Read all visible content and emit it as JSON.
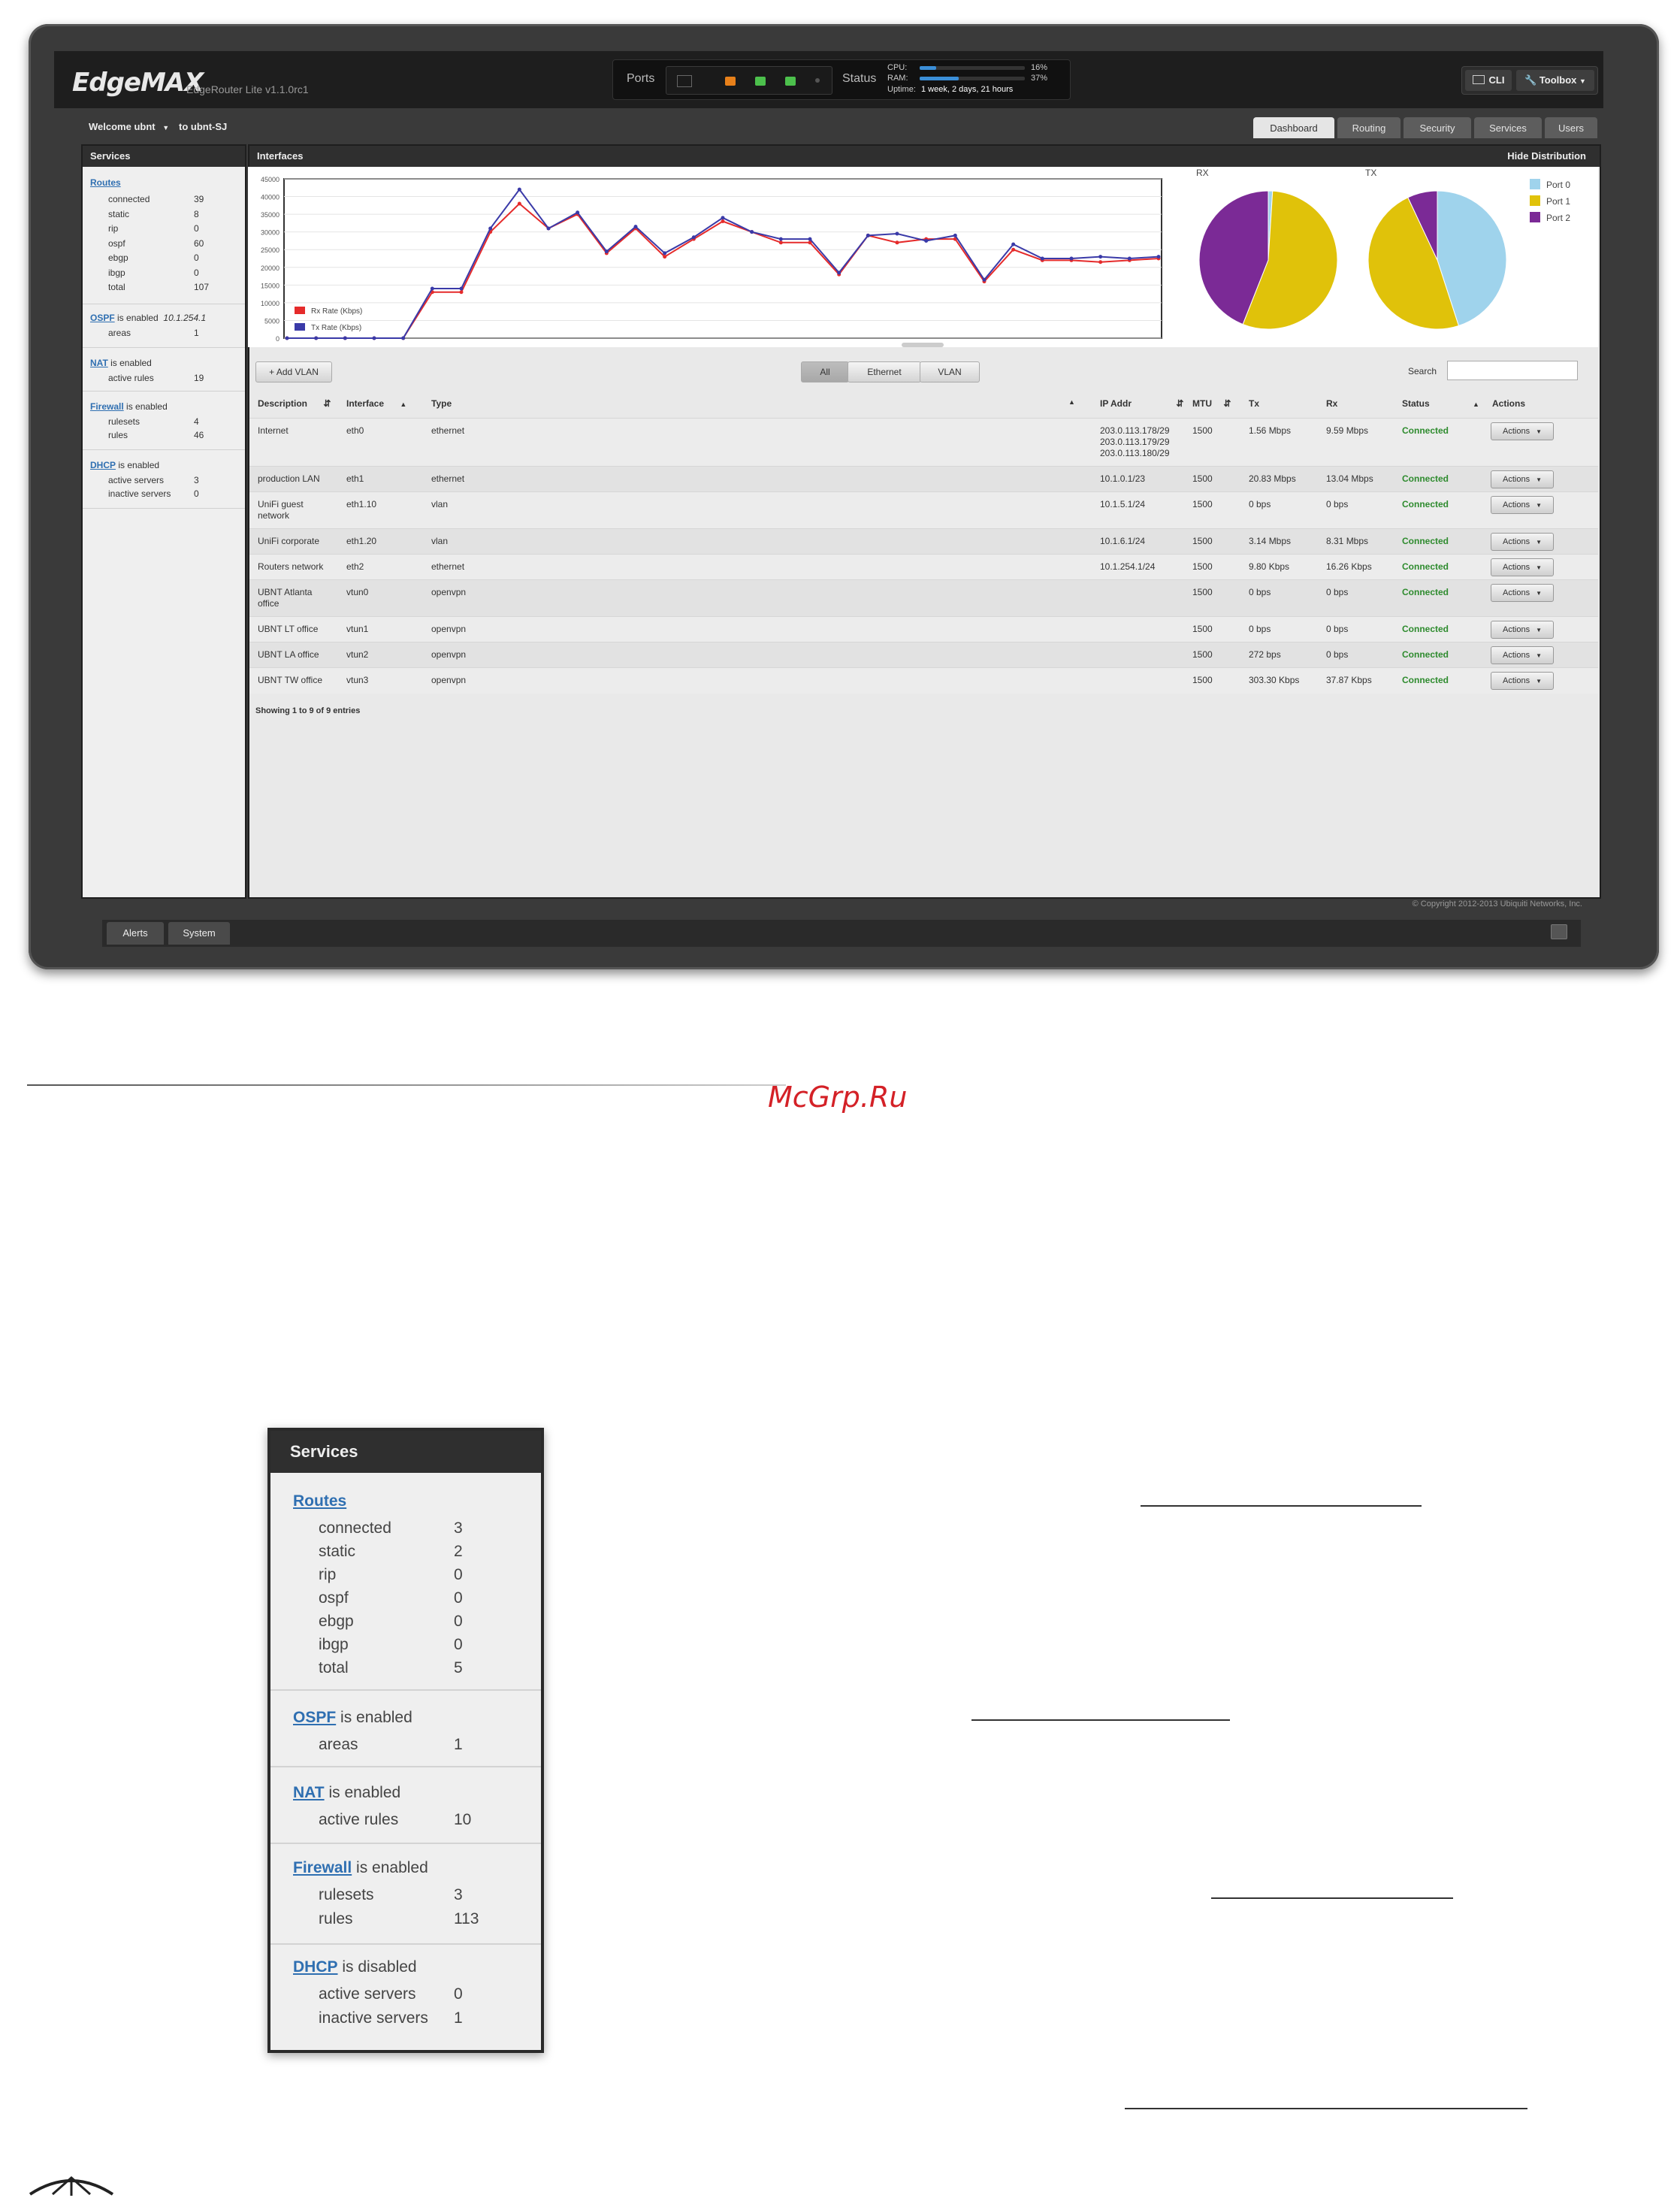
{
  "app": {
    "logo": "EdgeMAX",
    "product_version": "EdgeRouter Lite v1.1.0rc1",
    "ports_label": "Ports",
    "status_label": "Status",
    "cpu_label": "CPU:",
    "cpu_value": "16%",
    "cpu_fraction": 0.16,
    "ram_label": "RAM:",
    "ram_value": "37%",
    "ram_fraction": 0.37,
    "uptime_label": "Uptime:",
    "uptime_value": "1 week, 2 days, 21 hours",
    "cli_label": "CLI",
    "toolbox_label": "Toolbox"
  },
  "user": {
    "welcome": "Welcome ubnt",
    "host": "to ubnt-SJ"
  },
  "tabs": [
    "Dashboard",
    "Routing",
    "Security",
    "Services",
    "Users"
  ],
  "sidebar": {
    "title": "Services",
    "routes_link": "Routes",
    "routes": [
      {
        "label": "connected",
        "value": "39"
      },
      {
        "label": "static",
        "value": "8"
      },
      {
        "label": "rip",
        "value": "0"
      },
      {
        "label": "ospf",
        "value": "60"
      },
      {
        "label": "ebgp",
        "value": "0"
      },
      {
        "label": "ibgp",
        "value": "0"
      },
      {
        "label": "total",
        "value": "107"
      }
    ],
    "ospf_link": "OSPF",
    "ospf_status": "is enabled",
    "ospf_id": "10.1.254.1",
    "ospf_areas_label": "areas",
    "ospf_areas_value": "1",
    "nat_link": "NAT",
    "nat_status": "is enabled",
    "nat_rules_label": "active rules",
    "nat_rules_value": "19",
    "firewall_link": "Firewall",
    "firewall_status": "is enabled",
    "firewall_rulesets_label": "rulesets",
    "firewall_rulesets_value": "4",
    "firewall_rules_label": "rules",
    "firewall_rules_value": "46",
    "dhcp_link": "DHCP",
    "dhcp_status": "is enabled",
    "dhcp_active_label": "active servers",
    "dhcp_active_value": "3",
    "dhcp_inactive_label": "inactive servers",
    "dhcp_inactive_value": "0"
  },
  "interfaces_panel": {
    "title": "Interfaces",
    "hide_distribution": "Hide Distribution",
    "rx_label": "RX",
    "tx_label": "TX"
  },
  "chart_data": [
    {
      "type": "line",
      "title": "",
      "xlabel": "",
      "ylabel": "",
      "ylim": [
        0,
        45000
      ],
      "yticks": [
        "0",
        "5000",
        "10000",
        "15000",
        "20000",
        "25000",
        "30000",
        "35000",
        "40000",
        "45000"
      ],
      "x": [
        1,
        2,
        3,
        4,
        5,
        6,
        7,
        8,
        9,
        10,
        11,
        12,
        13,
        14,
        15,
        16,
        17,
        18,
        19,
        20,
        21,
        22,
        23,
        24,
        25,
        26,
        27,
        28,
        29,
        30,
        31
      ],
      "series": [
        {
          "name": "Rx Rate (Kbps)",
          "color": "#e52b2b",
          "values": [
            0,
            0,
            0,
            0,
            0,
            13000,
            13000,
            30000,
            38000,
            31000,
            35000,
            24000,
            31000,
            23000,
            28000,
            33000,
            30000,
            27000,
            27000,
            18000,
            29000,
            27000,
            28000,
            28000,
            16000,
            25000,
            22000,
            22000,
            21500,
            22000,
            22500
          ]
        },
        {
          "name": "Tx Rate (Kbps)",
          "color": "#3a3aa8",
          "values": [
            0,
            0,
            0,
            0,
            0,
            14000,
            14000,
            31000,
            42000,
            31000,
            35500,
            24500,
            31500,
            24000,
            28500,
            34000,
            30000,
            28000,
            28000,
            18500,
            29000,
            29500,
            27500,
            29000,
            16500,
            26500,
            22500,
            22500,
            23000,
            22500,
            23000
          ]
        }
      ]
    },
    {
      "type": "pie",
      "title": "RX",
      "categories": [
        "Port 0",
        "Port 1",
        "Port 2"
      ],
      "values": [
        1,
        55,
        44
      ],
      "colors": [
        "#9fd3ec",
        "#e0c20a",
        "#7b2a96"
      ]
    },
    {
      "type": "pie",
      "title": "TX",
      "categories": [
        "Port 0",
        "Port 1",
        "Port 2"
      ],
      "values": [
        45,
        48,
        7
      ],
      "colors": [
        "#9fd3ec",
        "#e0c20a",
        "#7b2a96"
      ]
    }
  ],
  "table": {
    "add_vlan": "+ Add VLAN",
    "filters": [
      "All",
      "Ethernet",
      "VLAN"
    ],
    "search_label": "Search",
    "search_value": "",
    "columns": [
      "Description",
      "Interface",
      "Type",
      "IP Addr",
      "MTU",
      "Tx",
      "Rx",
      "Status",
      "Actions"
    ],
    "rows": [
      {
        "desc": [
          "Internet"
        ],
        "iface": "eth0",
        "type": "ethernet",
        "ip": [
          "203.0.113.178/29",
          "203.0.113.179/29",
          "203.0.113.180/29"
        ],
        "mtu": "1500",
        "tx": "1.56 Mbps",
        "rx": "9.59 Mbps",
        "status": "Connected",
        "action": "Actions"
      },
      {
        "desc": [
          "production LAN"
        ],
        "iface": "eth1",
        "type": "ethernet",
        "ip": [
          "10.1.0.1/23"
        ],
        "mtu": "1500",
        "tx": "20.83 Mbps",
        "rx": "13.04 Mbps",
        "status": "Connected",
        "action": "Actions"
      },
      {
        "desc": [
          "UniFi guest",
          "network"
        ],
        "iface": "eth1.10",
        "type": "vlan",
        "ip": [
          "10.1.5.1/24"
        ],
        "mtu": "1500",
        "tx": "0 bps",
        "rx": "0 bps",
        "status": "Connected",
        "action": "Actions"
      },
      {
        "desc": [
          "UniFi corporate"
        ],
        "iface": "eth1.20",
        "type": "vlan",
        "ip": [
          "10.1.6.1/24"
        ],
        "mtu": "1500",
        "tx": "3.14 Mbps",
        "rx": "8.31 Mbps",
        "status": "Connected",
        "action": "Actions"
      },
      {
        "desc": [
          "Routers network"
        ],
        "iface": "eth2",
        "type": "ethernet",
        "ip": [
          "10.1.254.1/24"
        ],
        "mtu": "1500",
        "tx": "9.80 Kbps",
        "rx": "16.26 Kbps",
        "status": "Connected",
        "action": "Actions"
      },
      {
        "desc": [
          "UBNT Atlanta",
          "office"
        ],
        "iface": "vtun0",
        "type": "openvpn",
        "ip": [],
        "mtu": "1500",
        "tx": "0 bps",
        "rx": "0 bps",
        "status": "Connected",
        "action": "Actions"
      },
      {
        "desc": [
          "UBNT LT office"
        ],
        "iface": "vtun1",
        "type": "openvpn",
        "ip": [],
        "mtu": "1500",
        "tx": "0 bps",
        "rx": "0 bps",
        "status": "Connected",
        "action": "Actions"
      },
      {
        "desc": [
          "UBNT LA office"
        ],
        "iface": "vtun2",
        "type": "openvpn",
        "ip": [],
        "mtu": "1500",
        "tx": "272 bps",
        "rx": "0 bps",
        "status": "Connected",
        "action": "Actions"
      },
      {
        "desc": [
          "UBNT TW office"
        ],
        "iface": "vtun3",
        "type": "openvpn",
        "ip": [],
        "mtu": "1500",
        "tx": "303.30 Kbps",
        "rx": "37.87 Kbps",
        "status": "Connected",
        "action": "Actions"
      }
    ],
    "footer": "Showing 1 to 9 of 9 entries"
  },
  "copyright": "© Copyright 2012-2013 Ubiquiti Networks, Inc.",
  "bottom_tabs": [
    "Alerts",
    "System"
  ],
  "watermark": "McGrp.Ru",
  "zoom_panel": {
    "title": "Services",
    "routes_link": "Routes",
    "routes": [
      {
        "label": "connected",
        "value": "3"
      },
      {
        "label": "static",
        "value": "2"
      },
      {
        "label": "rip",
        "value": "0"
      },
      {
        "label": "ospf",
        "value": "0"
      },
      {
        "label": "ebgp",
        "value": "0"
      },
      {
        "label": "ibgp",
        "value": "0"
      },
      {
        "label": "total",
        "value": "5"
      }
    ],
    "ospf_link": "OSPF",
    "ospf_status": "is enabled",
    "ospf_areas_label": "areas",
    "ospf_areas_value": "1",
    "nat_link": "NAT",
    "nat_status": "is enabled",
    "nat_rules_label": "active rules",
    "nat_rules_value": "10",
    "firewall_link": "Firewall",
    "firewall_status": "is enabled",
    "firewall_rulesets_label": "rulesets",
    "firewall_rulesets_value": "3",
    "firewall_rules_label": "rules",
    "firewall_rules_value": "113",
    "dhcp_link": "DHCP",
    "dhcp_status": "is disabled",
    "dhcp_active_label": "active servers",
    "dhcp_active_value": "0",
    "dhcp_inactive_label": "inactive servers",
    "dhcp_inactive_value": "1"
  }
}
